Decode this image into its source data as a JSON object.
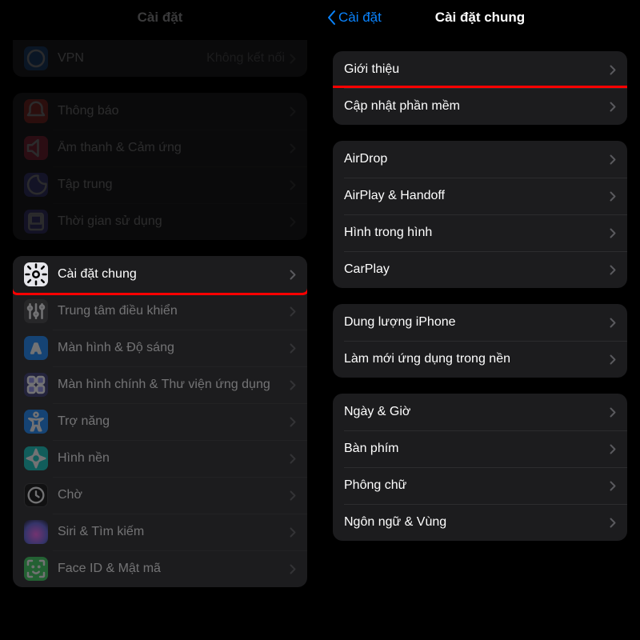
{
  "left": {
    "title": "Cài đặt",
    "groups": [
      {
        "partialTop": true,
        "items": [
          {
            "icon": "vpn-icon",
            "label": "VPN",
            "detail": "Không kết nối"
          }
        ]
      },
      {
        "items": [
          {
            "icon": "notifications-icon",
            "label": "Thông báo"
          },
          {
            "icon": "sounds-icon",
            "label": "Âm thanh & Cảm ứng"
          },
          {
            "icon": "focus-icon",
            "label": "Tập trung"
          },
          {
            "icon": "screentime-icon",
            "label": "Thời gian sử dụng"
          }
        ]
      },
      {
        "items": [
          {
            "icon": "general-icon",
            "label": "Cài đặt chung",
            "highlight": true
          },
          {
            "icon": "controlcenter-icon",
            "label": "Trung tâm điều khiển"
          },
          {
            "icon": "display-icon",
            "label": "Màn hình & Độ sáng"
          },
          {
            "icon": "homescreen-icon",
            "label": "Màn hình chính & Thư viện ứng dụng",
            "multi": true
          },
          {
            "icon": "accessibility-icon",
            "label": "Trợ năng"
          },
          {
            "icon": "wallpaper-icon",
            "label": "Hình nền"
          },
          {
            "icon": "standby-icon",
            "label": "Chờ"
          },
          {
            "icon": "siri-icon",
            "label": "Siri & Tìm kiếm"
          },
          {
            "icon": "faceid-icon",
            "label": "Face ID & Mật mã"
          }
        ]
      }
    ]
  },
  "right": {
    "back": "Cài đặt",
    "title": "Cài đặt chung",
    "groups": [
      {
        "items": [
          {
            "label": "Giới thiệu"
          },
          {
            "label": "Cập nhật phần mềm",
            "highlight": true
          }
        ]
      },
      {
        "items": [
          {
            "label": "AirDrop"
          },
          {
            "label": "AirPlay & Handoff"
          },
          {
            "label": "Hình trong hình"
          },
          {
            "label": "CarPlay"
          }
        ]
      },
      {
        "items": [
          {
            "label": "Dung lượng iPhone"
          },
          {
            "label": "Làm mới ứng dụng trong nền"
          }
        ]
      },
      {
        "items": [
          {
            "label": "Ngày & Giờ"
          },
          {
            "label": "Bàn phím"
          },
          {
            "label": "Phông chữ"
          },
          {
            "label": "Ngôn ngữ & Vùng"
          }
        ]
      }
    ]
  }
}
